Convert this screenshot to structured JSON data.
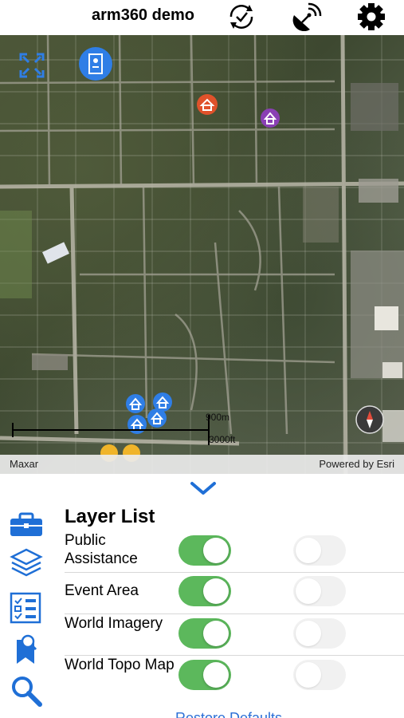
{
  "header": {
    "title": "arm360 demo",
    "icons": [
      "sync-icon",
      "satellite-dish-icon",
      "gear-icon"
    ]
  },
  "map": {
    "attribution_left": "Maxar",
    "attribution_right": "Powered by Esri",
    "scale_metric": "900m",
    "scale_imperial": "3000ft",
    "markers": [
      "house-marker-orange",
      "house-marker-purple",
      "house-marker-blue"
    ],
    "controls": [
      "extent-icon",
      "legend-button",
      "compass-icon"
    ]
  },
  "panel": {
    "title": "Layer List",
    "collapse_icon": "chevron-down-icon",
    "sidebar_icons": [
      "toolbox-icon",
      "layers-icon",
      "checklist-icon",
      "bookmark-icon",
      "search-icon"
    ],
    "layers": [
      {
        "label": "Public Assistance",
        "visible": true,
        "secondary": false
      },
      {
        "label": "Event Area",
        "visible": true,
        "secondary": false
      },
      {
        "label": "World Imagery",
        "visible": true,
        "secondary": false
      },
      {
        "label": "World Topo Map",
        "visible": true,
        "secondary": false
      }
    ],
    "restore_label": "Restore Defaults"
  },
  "colors": {
    "accent": "#1f6fd6",
    "toggle_on": "#5cb85c",
    "marker_orange": "#e0522b",
    "marker_purple": "#8a3fb4"
  }
}
